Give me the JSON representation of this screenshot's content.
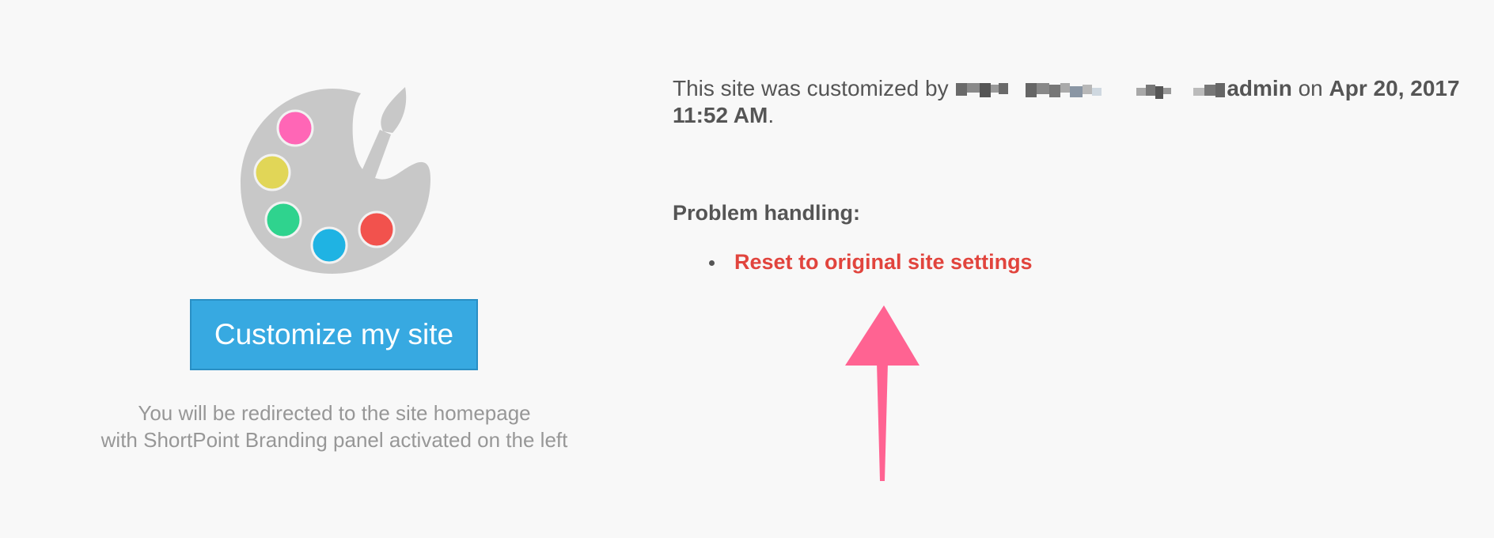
{
  "customize": {
    "button_label": "Customize my site",
    "note_line1": "You will be redirected to the site homepage",
    "note_line2": "with ShortPoint Branding panel activated on the left"
  },
  "info": {
    "prefix": "This site was customized by",
    "user_suffix": "admin",
    "on_word": "on",
    "date": "Apr 20, 2017",
    "time": "11:52 AM",
    "period": "."
  },
  "problem": {
    "heading": "Problem handling:",
    "links": [
      {
        "label": "Reset to original site settings"
      }
    ]
  },
  "colors": {
    "button_bg": "#37a9e1",
    "link": "#e1443d",
    "arrow": "#ff6392",
    "palette": "#c8c8c8"
  },
  "icons": {
    "palette": "palette-icon",
    "arrow": "arrow-up-icon"
  }
}
